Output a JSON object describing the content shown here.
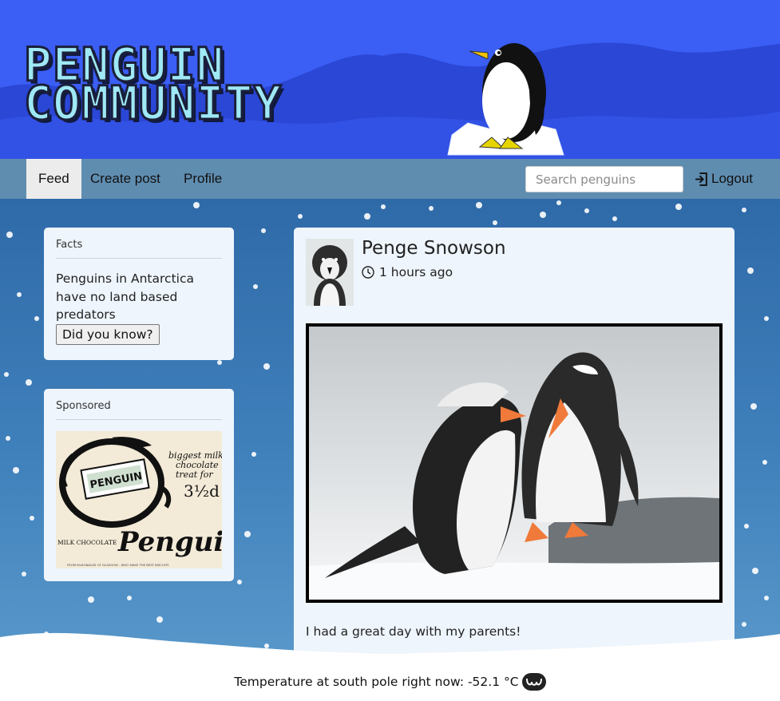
{
  "header": {
    "logo_line1": "PENGUIN",
    "logo_line2": "COMMUNITY"
  },
  "nav": {
    "items": [
      {
        "label": "Feed",
        "active": true
      },
      {
        "label": "Create post",
        "active": false
      },
      {
        "label": "Profile",
        "active": false
      }
    ],
    "search_placeholder": "Search penguins",
    "logout_label": "Logout",
    "logout_icon": "logout-icon"
  },
  "sidebar": {
    "facts": {
      "title": "Facts",
      "text": "Penguins in Antarctica have no land based predators",
      "button_label": "Did you know?"
    },
    "sponsored": {
      "title": "Sponsored",
      "ad": {
        "brand": "PENGUIN",
        "tagline_1": "biggest milk",
        "tagline_2": "chocolate",
        "tagline_3": "treat for",
        "price": "3½d",
        "product": "MILK CHOCOLATE",
        "logo_word": "Penguin",
        "footer": "FROM McDONALDS OF GLASGOW - WHO MAKE THE BEST BISCUITS"
      }
    }
  },
  "post": {
    "author": "Penge Snowson",
    "time": "1 hours ago",
    "time_icon": "clock-icon",
    "text": "I had a great day with my parents!"
  },
  "footer": {
    "temperature_text": "Temperature at south pole right now: -52.1 °C",
    "weather_icon": "wave-logo-icon"
  },
  "colors": {
    "header_bg": "#3b5ef5",
    "nav_bg": "#5f8db0",
    "card_bg": "#eef5fc",
    "logo_fill": "#9fe8f5"
  }
}
